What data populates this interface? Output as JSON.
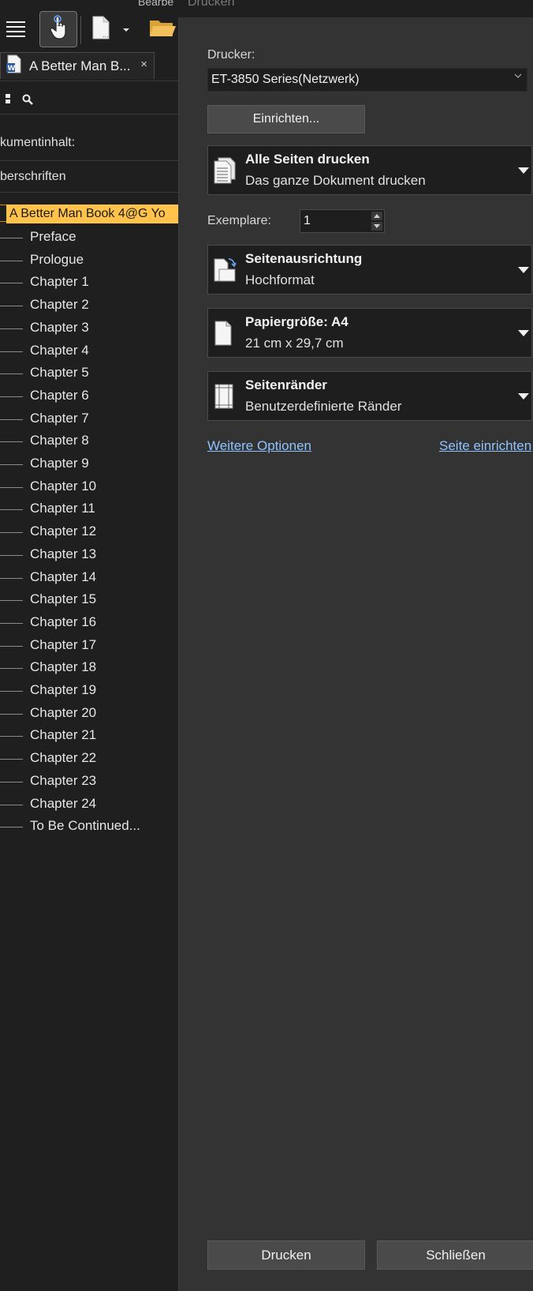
{
  "app": {
    "menu_partial": "Bearbe",
    "toolbar": {
      "menu_icon": "hamburger-icon",
      "touch_icon": "touch-hand-icon",
      "new_icon": "new-document-icon",
      "open_icon": "open-folder-icon"
    },
    "document_tab": {
      "title": "A Better Man B...",
      "close": "×",
      "icon": "word-document-icon"
    },
    "navigator": {
      "content_label": "kumentinhalt:",
      "headings_label": "berschriften",
      "root": "A Better Man Book 4@G Yo",
      "items": [
        "Preface",
        "Prologue",
        "Chapter 1",
        "Chapter 2",
        "Chapter 3",
        "Chapter 4",
        "Chapter 5",
        "Chapter 6",
        "Chapter 7",
        "Chapter 8",
        "Chapter 9",
        "Chapter 10",
        "Chapter 11",
        "Chapter 12",
        "Chapter 13",
        "Chapter 14",
        "Chapter 15",
        "Chapter 16",
        "Chapter 17",
        "Chapter 18",
        "Chapter 19",
        "Chapter 20",
        "Chapter 21",
        "Chapter 22",
        "Chapter 23",
        "Chapter 24",
        "To Be Continued..."
      ]
    }
  },
  "dialog": {
    "title": "Drucken",
    "printer_label": "Drucker:",
    "printer_value": "ET-3850 Series(Netzwerk)",
    "setup_button": "Einrichten...",
    "copies_label": "Exemplare:",
    "copies_value": "1",
    "options": {
      "pages": {
        "title": "Alle Seiten drucken",
        "subtitle": "Das ganze Dokument drucken"
      },
      "orientation": {
        "title": "Seitenausrichtung",
        "subtitle": "Hochformat"
      },
      "paper": {
        "title": "Papiergröße: A4",
        "subtitle": "21 cm x 29,7 cm"
      },
      "margins": {
        "title": "Seitenränder",
        "subtitle": "Benutzerdefinierte Ränder"
      }
    },
    "more_options_link": "Weitere Optionen",
    "page_setup_link": "Seite einrichten",
    "print_button": "Drucken",
    "close_button": "Schließen"
  },
  "colors": {
    "outline_highlight": "#ffc24a",
    "link": "#8ec4ff",
    "dialog_bg": "#333333",
    "app_bg": "#1f1f1f"
  }
}
